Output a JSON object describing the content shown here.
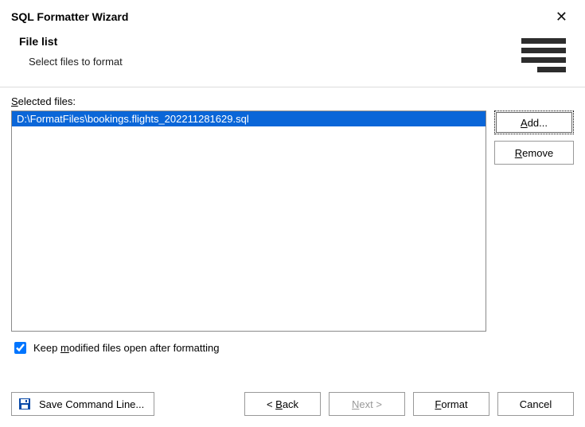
{
  "window": {
    "title": "SQL Formatter Wizard"
  },
  "header": {
    "page_title": "File list",
    "subtitle": "Select files to format"
  },
  "list": {
    "label_pre": "S",
    "label_rest": "elected files:",
    "items": [
      "D:\\FormatFiles\\bookings.flights_202211281629.sql"
    ]
  },
  "side": {
    "add_pre": "A",
    "add_rest": "dd...",
    "remove_pre": "R",
    "remove_rest": "emove"
  },
  "checkbox": {
    "checked": true,
    "text_pre": "Keep ",
    "text_u": "m",
    "text_rest": "odified files open after formatting"
  },
  "footer": {
    "save_cmd": "Save Command Line...",
    "back_pre": "< ",
    "back_u": "B",
    "back_rest": "ack",
    "next_pre": "",
    "next_u": "N",
    "next_rest": "ext >",
    "format_pre": "",
    "format_u": "F",
    "format_rest": "ormat",
    "cancel": "Cancel"
  }
}
